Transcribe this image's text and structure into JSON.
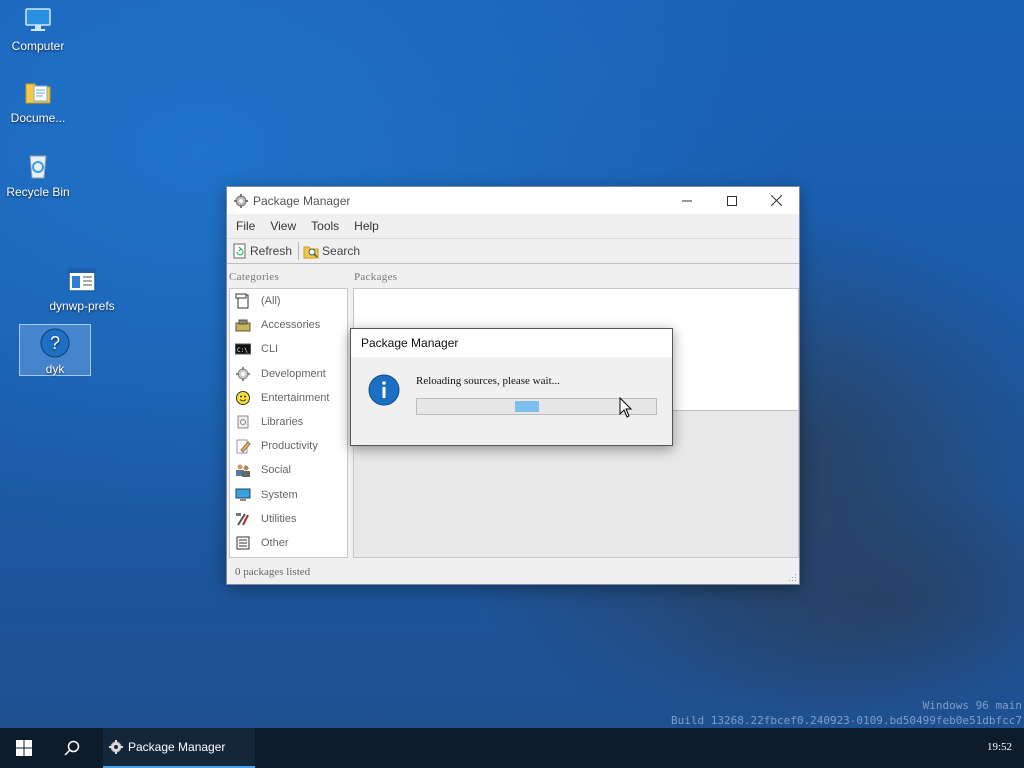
{
  "desktop": {
    "icons": [
      {
        "label": "Computer",
        "icon": "computer-icon"
      },
      {
        "label": "Docume...",
        "icon": "documents-folder-icon"
      },
      {
        "label": "Recycle Bin",
        "icon": "recycle-bin-icon"
      },
      {
        "label": "dynwp-prefs",
        "icon": "window-settings-icon"
      },
      {
        "label": "dyk",
        "icon": "help-question-icon",
        "selected": true
      }
    ],
    "watermark": {
      "line1": "Windows 96 main",
      "line2": "Build 13268.22fbcef0.240923-0109.bd50499feb0e51dbfcc7"
    }
  },
  "window": {
    "title": "Package Manager",
    "menu": [
      "File",
      "View",
      "Tools",
      "Help"
    ],
    "toolbar": {
      "refresh_label": "Refresh",
      "search_label": "Search"
    },
    "categories_label": "Categories",
    "packages_label": "Packages",
    "categories": [
      {
        "label": "(All)",
        "icon": "all-packages-icon"
      },
      {
        "label": "Accessories",
        "icon": "accessories-icon"
      },
      {
        "label": "CLI",
        "icon": "terminal-icon"
      },
      {
        "label": "Development",
        "icon": "development-gear-icon"
      },
      {
        "label": "Entertainment",
        "icon": "smiley-icon"
      },
      {
        "label": "Libraries",
        "icon": "library-icon"
      },
      {
        "label": "Productivity",
        "icon": "pencil-document-icon"
      },
      {
        "label": "Social",
        "icon": "users-icon"
      },
      {
        "label": "System",
        "icon": "monitor-icon"
      },
      {
        "label": "Utilities",
        "icon": "tools-icon"
      },
      {
        "label": "Other",
        "icon": "other-icon"
      }
    ],
    "status": "0 packages listed"
  },
  "dialog": {
    "title": "Package Manager",
    "message": "Reloading sources, please wait...",
    "icon": "info-icon"
  },
  "taskbar": {
    "task_label": "Package Manager",
    "clock": "19:52"
  },
  "colors": {
    "accent": "#4aa3f0",
    "progress": "#7cc0f0",
    "taskbar": "#0d1b2a"
  }
}
